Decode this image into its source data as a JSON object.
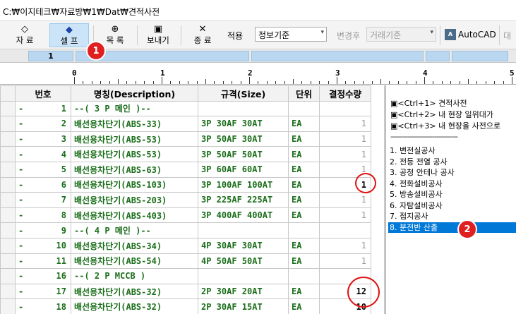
{
  "window": {
    "title": "C:₩이지테크₩자료방₩1₩Dat₩견적사전"
  },
  "toolbar": {
    "buttons": [
      {
        "label": "자 료",
        "icon": "eraser-icon",
        "glyph": "◇"
      },
      {
        "label": "셀 프",
        "icon": "eraser-icon",
        "glyph": "◆"
      },
      {
        "label": "목 록",
        "icon": "zoom-icon",
        "glyph": "⊕"
      },
      {
        "label": "보내기",
        "icon": "floppy-icon",
        "glyph": "▣"
      },
      {
        "label": "종 료",
        "icon": "close-icon",
        "glyph": "✕"
      }
    ],
    "apply_label": "적용",
    "apply_value": "정보기준",
    "after_change_label": "변경후",
    "after_change_value": "거래기준",
    "autocad_label": "AutoCAD",
    "trailing_label": "대"
  },
  "bluebar": {
    "first_cell": "1"
  },
  "ruler": {
    "numbers": [
      "0",
      "1",
      "2",
      "3",
      "4",
      "5"
    ]
  },
  "table": {
    "headers": [
      "번호",
      "명칭(Description)",
      "규격(Size)",
      "단위",
      "결정수량"
    ],
    "rows": [
      {
        "dash": "-",
        "no": "1",
        "name": "--( 3 P 메인 )--",
        "size": "",
        "unit": "",
        "qty": ""
      },
      {
        "dash": "-",
        "no": "2",
        "name": "배선용차단기(ABS-33)",
        "size": "3P 30AF 30AT",
        "unit": "EA",
        "qty": "1"
      },
      {
        "dash": "-",
        "no": "3",
        "name": "배선용차단기(ABS-53)",
        "size": "3P 50AF 30AT",
        "unit": "EA",
        "qty": "1"
      },
      {
        "dash": "-",
        "no": "4",
        "name": "배선용차단기(ABS-53)",
        "size": "3P 50AF 50AT",
        "unit": "EA",
        "qty": "1"
      },
      {
        "dash": "-",
        "no": "5",
        "name": "배선용차단기(ABS-63)",
        "size": "3P 60AF 60AT",
        "unit": "EA",
        "qty": "1"
      },
      {
        "dash": "-",
        "no": "6",
        "name": "배선용차단기(ABS-103)",
        "size": "3P 100AF 100AT",
        "unit": "EA",
        "qty": "1"
      },
      {
        "dash": "-",
        "no": "7",
        "name": "배선용차단기(ABS-203)",
        "size": "3P 225AF 225AT",
        "unit": "EA",
        "qty": "1"
      },
      {
        "dash": "-",
        "no": "8",
        "name": "배선용차단기(ABS-403)",
        "size": "3P 400AF 400AT",
        "unit": "EA",
        "qty": "1"
      },
      {
        "dash": "-",
        "no": "9",
        "name": "--( 4 P 메인 )--",
        "size": "",
        "unit": "",
        "qty": ""
      },
      {
        "dash": "-",
        "no": "10",
        "name": "배선용차단기(ABS-34)",
        "size": "4P 30AF 30AT",
        "unit": "EA",
        "qty": "1"
      },
      {
        "dash": "-",
        "no": "11",
        "name": "배선용차단기(ABS-54)",
        "size": "4P 50AF 50AT",
        "unit": "EA",
        "qty": "1"
      },
      {
        "dash": "-",
        "no": "16",
        "name": "--( 2 P MCCB )",
        "size": "",
        "unit": "",
        "qty": ""
      },
      {
        "dash": "-",
        "no": "17",
        "name": "배선용차단기(ABS-32)",
        "size": "2P 30AF 20AT",
        "unit": "EA",
        "qty": "12"
      },
      {
        "dash": "-",
        "no": "18",
        "name": "배선용차단기(ABS-32)",
        "size": "2P 30AF 15AT",
        "unit": "EA",
        "qty": "10"
      }
    ]
  },
  "panel": {
    "options": [
      "▣<Ctrl+1> 견적사전",
      "▣<Ctrl+2> 내 현장 일위대가",
      "▣<Ctrl+3> 내 현장을 사전으로"
    ],
    "separator": "--------------------------------",
    "items": [
      "1. 변전실공사",
      "2. 전등 전열 공사",
      "3. 공청 안테나 공사",
      "4. 전화설비공사",
      "5. 방송설비공사",
      "6. 자탐설비공사",
      "7. 접지공사",
      "8. 분전반 산출"
    ],
    "selected_index": 7
  },
  "annotations": {
    "marker1": "1",
    "marker2": "2"
  }
}
